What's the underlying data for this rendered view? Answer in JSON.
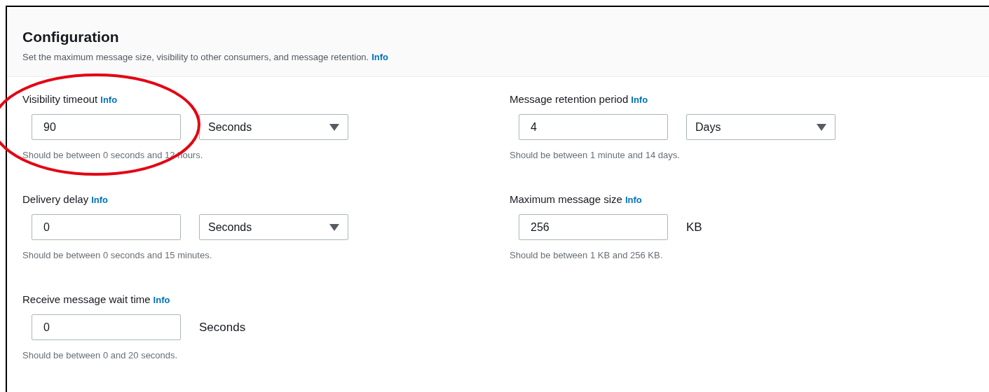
{
  "panel": {
    "title": "Configuration",
    "description": "Set the maximum message size, visibility to other consumers, and message retention.",
    "info_link": "Info"
  },
  "columns": [
    [
      {
        "label": "Visibility timeout",
        "info": "Info",
        "value": "90",
        "unit": {
          "kind": "select",
          "text": "Seconds"
        },
        "hint": "Should be between 0 seconds and 12 hours.",
        "highlighted": true
      },
      {
        "label": "Delivery delay",
        "info": "Info",
        "value": "0",
        "unit": {
          "kind": "select",
          "text": "Seconds"
        },
        "hint": "Should be between 0 seconds and 15 minutes.",
        "highlighted": false
      },
      {
        "label": "Receive message wait time",
        "info": "Info",
        "value": "0",
        "unit": {
          "kind": "text",
          "text": "Seconds"
        },
        "hint": "Should be between 0 and 20 seconds.",
        "highlighted": false
      }
    ],
    [
      {
        "label": "Message retention period",
        "info": "Info",
        "value": "4",
        "unit": {
          "kind": "select",
          "text": "Days"
        },
        "hint": "Should be between 1 minute and 14 days.",
        "highlighted": false
      },
      {
        "label": "Maximum message size",
        "info": "Info",
        "value": "256",
        "unit": {
          "kind": "text",
          "text": "KB"
        },
        "hint": "Should be between 1 KB and 256 KB.",
        "highlighted": false
      }
    ]
  ]
}
